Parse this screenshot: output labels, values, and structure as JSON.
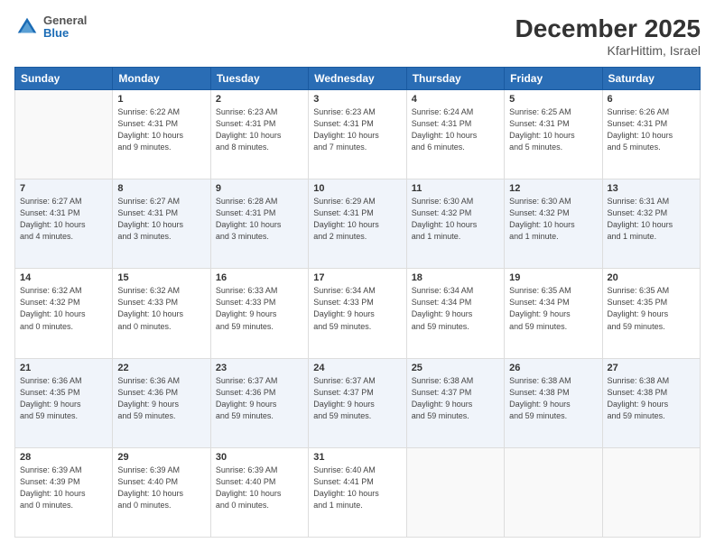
{
  "header": {
    "logo": {
      "general": "General",
      "blue": "Blue"
    },
    "title": "December 2025",
    "location": "KfarHittim, Israel"
  },
  "weekdays": [
    "Sunday",
    "Monday",
    "Tuesday",
    "Wednesday",
    "Thursday",
    "Friday",
    "Saturday"
  ],
  "weeks": [
    [
      {
        "day": "",
        "info": ""
      },
      {
        "day": "1",
        "info": "Sunrise: 6:22 AM\nSunset: 4:31 PM\nDaylight: 10 hours\nand 9 minutes."
      },
      {
        "day": "2",
        "info": "Sunrise: 6:23 AM\nSunset: 4:31 PM\nDaylight: 10 hours\nand 8 minutes."
      },
      {
        "day": "3",
        "info": "Sunrise: 6:23 AM\nSunset: 4:31 PM\nDaylight: 10 hours\nand 7 minutes."
      },
      {
        "day": "4",
        "info": "Sunrise: 6:24 AM\nSunset: 4:31 PM\nDaylight: 10 hours\nand 6 minutes."
      },
      {
        "day": "5",
        "info": "Sunrise: 6:25 AM\nSunset: 4:31 PM\nDaylight: 10 hours\nand 5 minutes."
      },
      {
        "day": "6",
        "info": "Sunrise: 6:26 AM\nSunset: 4:31 PM\nDaylight: 10 hours\nand 5 minutes."
      }
    ],
    [
      {
        "day": "7",
        "info": "Sunrise: 6:27 AM\nSunset: 4:31 PM\nDaylight: 10 hours\nand 4 minutes."
      },
      {
        "day": "8",
        "info": "Sunrise: 6:27 AM\nSunset: 4:31 PM\nDaylight: 10 hours\nand 3 minutes."
      },
      {
        "day": "9",
        "info": "Sunrise: 6:28 AM\nSunset: 4:31 PM\nDaylight: 10 hours\nand 3 minutes."
      },
      {
        "day": "10",
        "info": "Sunrise: 6:29 AM\nSunset: 4:31 PM\nDaylight: 10 hours\nand 2 minutes."
      },
      {
        "day": "11",
        "info": "Sunrise: 6:30 AM\nSunset: 4:32 PM\nDaylight: 10 hours\nand 1 minute."
      },
      {
        "day": "12",
        "info": "Sunrise: 6:30 AM\nSunset: 4:32 PM\nDaylight: 10 hours\nand 1 minute."
      },
      {
        "day": "13",
        "info": "Sunrise: 6:31 AM\nSunset: 4:32 PM\nDaylight: 10 hours\nand 1 minute."
      }
    ],
    [
      {
        "day": "14",
        "info": "Sunrise: 6:32 AM\nSunset: 4:32 PM\nDaylight: 10 hours\nand 0 minutes."
      },
      {
        "day": "15",
        "info": "Sunrise: 6:32 AM\nSunset: 4:33 PM\nDaylight: 10 hours\nand 0 minutes."
      },
      {
        "day": "16",
        "info": "Sunrise: 6:33 AM\nSunset: 4:33 PM\nDaylight: 9 hours\nand 59 minutes."
      },
      {
        "day": "17",
        "info": "Sunrise: 6:34 AM\nSunset: 4:33 PM\nDaylight: 9 hours\nand 59 minutes."
      },
      {
        "day": "18",
        "info": "Sunrise: 6:34 AM\nSunset: 4:34 PM\nDaylight: 9 hours\nand 59 minutes."
      },
      {
        "day": "19",
        "info": "Sunrise: 6:35 AM\nSunset: 4:34 PM\nDaylight: 9 hours\nand 59 minutes."
      },
      {
        "day": "20",
        "info": "Sunrise: 6:35 AM\nSunset: 4:35 PM\nDaylight: 9 hours\nand 59 minutes."
      }
    ],
    [
      {
        "day": "21",
        "info": "Sunrise: 6:36 AM\nSunset: 4:35 PM\nDaylight: 9 hours\nand 59 minutes."
      },
      {
        "day": "22",
        "info": "Sunrise: 6:36 AM\nSunset: 4:36 PM\nDaylight: 9 hours\nand 59 minutes."
      },
      {
        "day": "23",
        "info": "Sunrise: 6:37 AM\nSunset: 4:36 PM\nDaylight: 9 hours\nand 59 minutes."
      },
      {
        "day": "24",
        "info": "Sunrise: 6:37 AM\nSunset: 4:37 PM\nDaylight: 9 hours\nand 59 minutes."
      },
      {
        "day": "25",
        "info": "Sunrise: 6:38 AM\nSunset: 4:37 PM\nDaylight: 9 hours\nand 59 minutes."
      },
      {
        "day": "26",
        "info": "Sunrise: 6:38 AM\nSunset: 4:38 PM\nDaylight: 9 hours\nand 59 minutes."
      },
      {
        "day": "27",
        "info": "Sunrise: 6:38 AM\nSunset: 4:38 PM\nDaylight: 9 hours\nand 59 minutes."
      }
    ],
    [
      {
        "day": "28",
        "info": "Sunrise: 6:39 AM\nSunset: 4:39 PM\nDaylight: 10 hours\nand 0 minutes."
      },
      {
        "day": "29",
        "info": "Sunrise: 6:39 AM\nSunset: 4:40 PM\nDaylight: 10 hours\nand 0 minutes."
      },
      {
        "day": "30",
        "info": "Sunrise: 6:39 AM\nSunset: 4:40 PM\nDaylight: 10 hours\nand 0 minutes."
      },
      {
        "day": "31",
        "info": "Sunrise: 6:40 AM\nSunset: 4:41 PM\nDaylight: 10 hours\nand 1 minute."
      },
      {
        "day": "",
        "info": ""
      },
      {
        "day": "",
        "info": ""
      },
      {
        "day": "",
        "info": ""
      }
    ]
  ]
}
